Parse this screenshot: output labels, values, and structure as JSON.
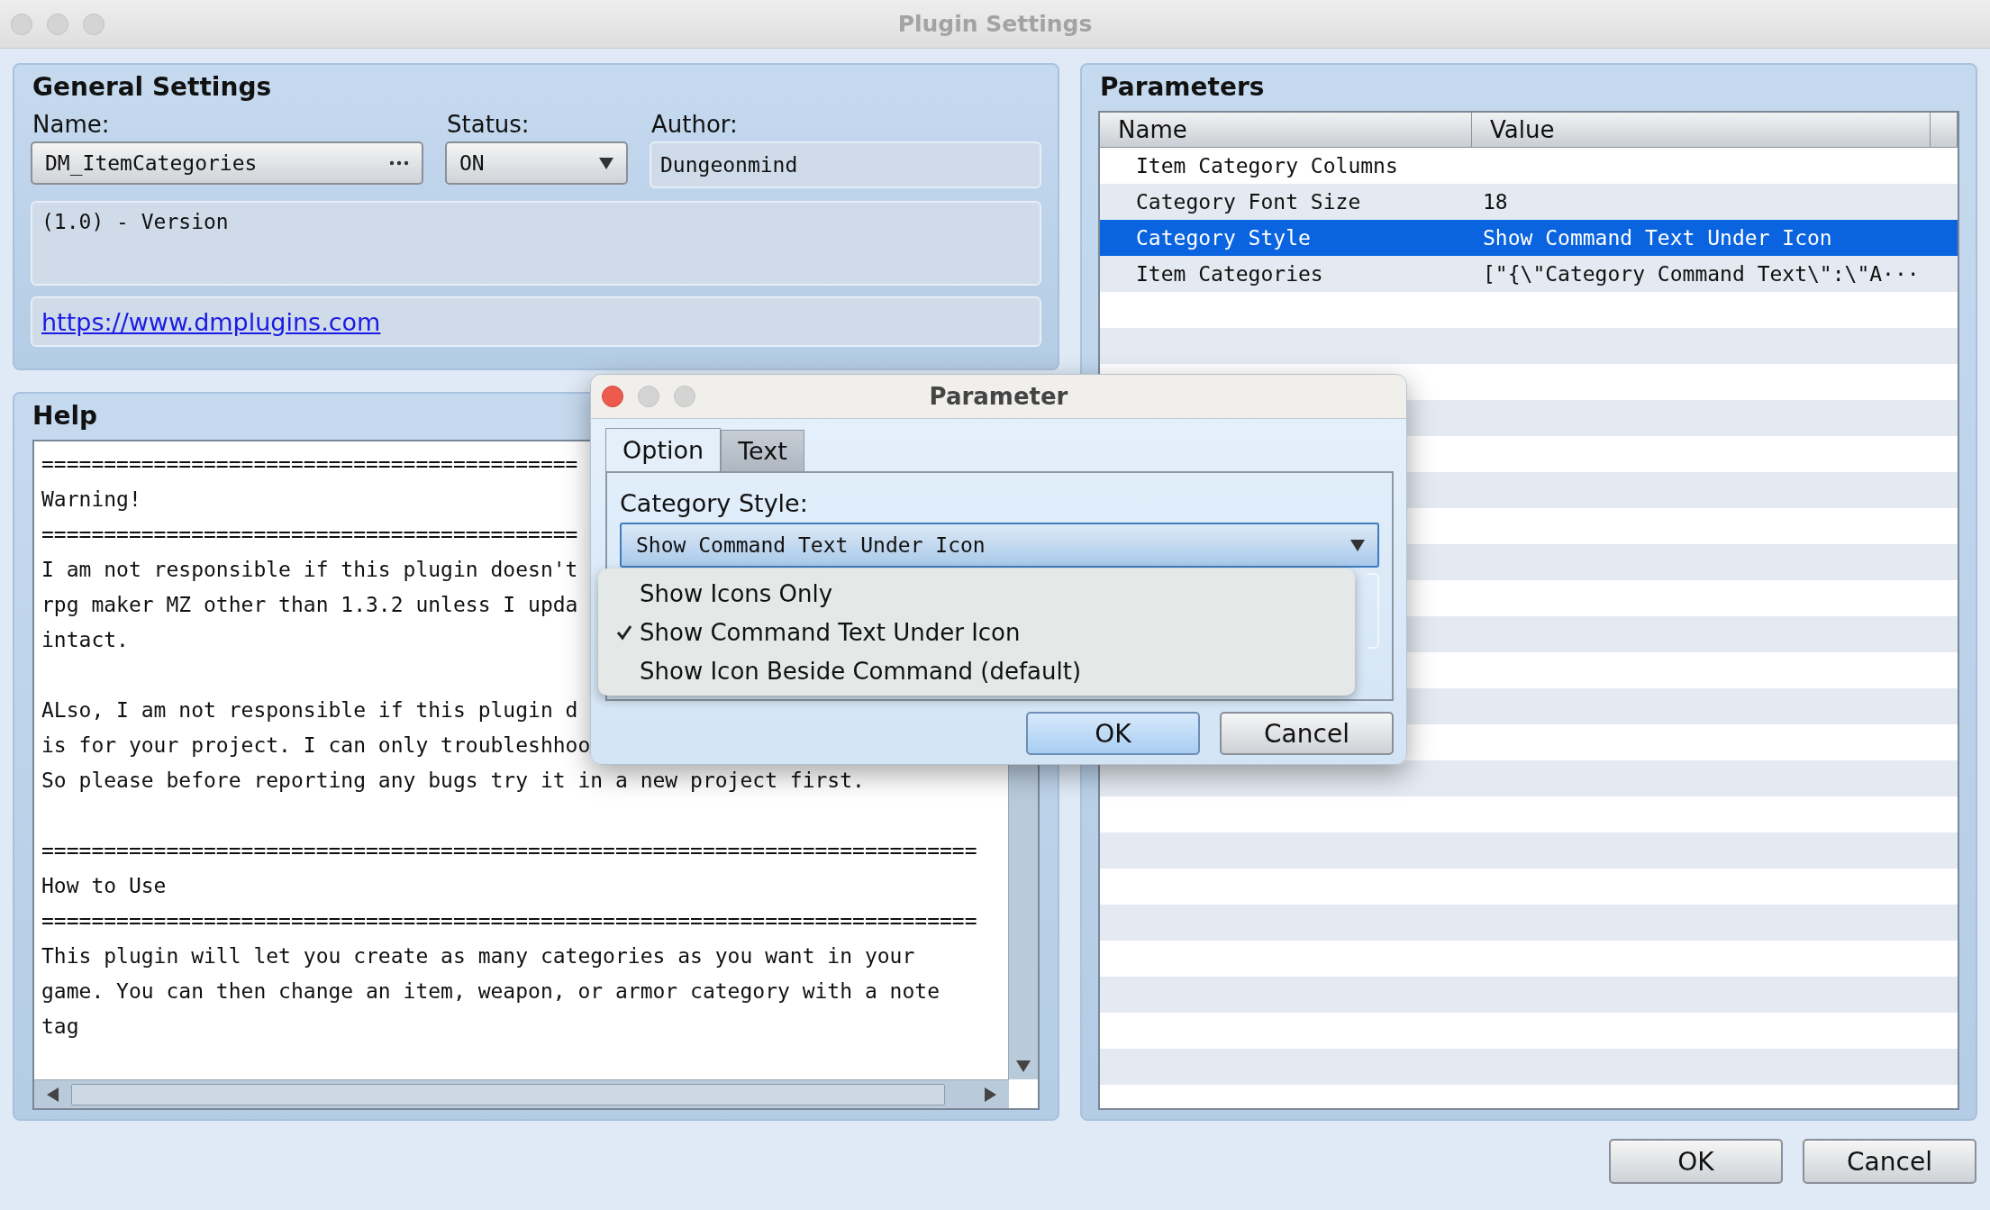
{
  "window": {
    "title": "Plugin Settings"
  },
  "general_settings": {
    "title": "General Settings",
    "name_label": "Name:",
    "name_value": "DM_ItemCategories",
    "status_label": "Status:",
    "status_value": "ON",
    "author_label": "Author:",
    "author_value": "Dungeonmind",
    "description": "(1.0) - Version",
    "url": "https://www.dmplugins.com"
  },
  "help": {
    "title": "Help",
    "lines": [
      {
        "kind": "text",
        "text": "==========================================="
      },
      {
        "kind": "text",
        "text": "Warning!"
      },
      {
        "kind": "text",
        "text": "==========================================="
      },
      {
        "kind": "text",
        "text": "I am not responsible if this plugin doesn't"
      },
      {
        "kind": "text",
        "text": "rpg maker MZ other than 1.3.2 unless I upda"
      },
      {
        "kind": "text",
        "text": "intact."
      },
      {
        "kind": "gap"
      },
      {
        "kind": "text",
        "text": "ALso, I am not responsible if this plugin d"
      },
      {
        "kind": "text",
        "text": "is for your project. I can only troubleshhoo"
      },
      {
        "kind": "text",
        "text": "So please before reporting any bugs try it in a new project first."
      },
      {
        "kind": "gap"
      },
      {
        "kind": "text",
        "text": "==========================================================================="
      },
      {
        "kind": "text",
        "text": "How to Use"
      },
      {
        "kind": "text",
        "text": "==========================================================================="
      },
      {
        "kind": "text",
        "text": "This plugin will let you create as many categories as you want in your"
      },
      {
        "kind": "text",
        "text": "game. You can then change an item, weapon, or armor category with a note"
      },
      {
        "kind": "text",
        "text": "tag"
      }
    ]
  },
  "parameters": {
    "title": "Parameters",
    "columns": [
      "Name",
      "Value"
    ],
    "rows": [
      {
        "name": "Item Category Columns",
        "selected": false
      },
      {
        "name": "Category Font Size",
        "value": "18",
        "selected": false
      },
      {
        "name": "Category Style",
        "value": "Show Command Text Under Icon",
        "selected": true
      },
      {
        "name": "Item Categories",
        "value": "[\"{\\\"Category Command Text\\\":\\\"A···",
        "selected": false
      }
    ]
  },
  "dialog": {
    "title": "Parameter",
    "tabs": [
      {
        "label": "Option",
        "selected": true
      },
      {
        "label": "Text",
        "selected": false
      }
    ],
    "field_label": "Category Style:",
    "field_value": "Show Command Text Under Icon",
    "options": [
      {
        "label": "Show Icons Only",
        "checked": false
      },
      {
        "label": "Show Command Text Under Icon",
        "checked": true
      },
      {
        "label": "Show Icon Beside Command (default)",
        "checked": false
      }
    ],
    "buttons": [
      {
        "label": "OK",
        "default": true
      },
      {
        "label": "Cancel",
        "default": false
      }
    ]
  },
  "buttons": [
    {
      "label": "OK",
      "default": false
    },
    {
      "label": "Cancel",
      "default": false
    }
  ]
}
